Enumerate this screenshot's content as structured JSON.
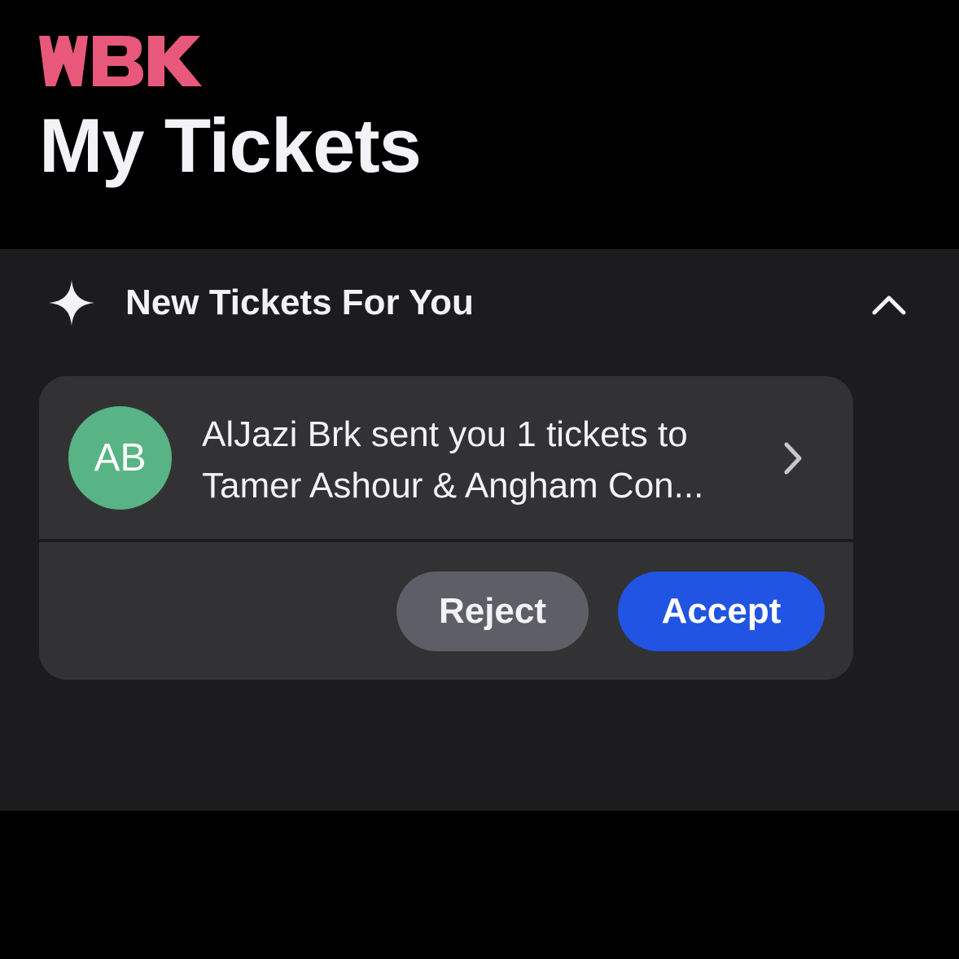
{
  "brand": {
    "logo_text": "WBK",
    "logo_color": "#e8587a"
  },
  "header": {
    "title": "My Tickets"
  },
  "new_tickets": {
    "section_title": "New Tickets For You",
    "sparkle_icon": "sparkle-icon",
    "collapse_icon": "chevron-up-icon",
    "card": {
      "avatar_initials": "AB",
      "avatar_color": "#58b484",
      "message_line1": "AlJazi Brk sent you 1 tickets to",
      "message_line2": "Tamer Ashour & Angham Con...",
      "open_icon": "chevron-right-icon",
      "reject_label": "Reject",
      "accept_label": "Accept"
    }
  },
  "colors": {
    "background": "#000000",
    "section_background": "#1c1c1e",
    "card_background": "#323234",
    "accept": "#2154e3",
    "reject": "#5e5e66"
  }
}
